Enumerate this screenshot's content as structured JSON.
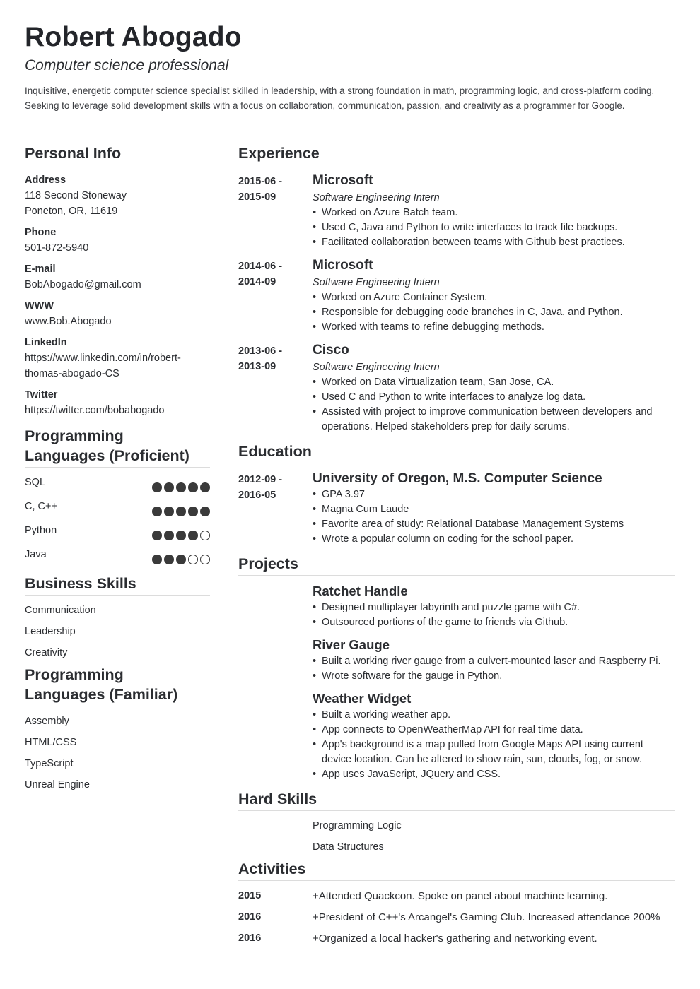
{
  "header": {
    "name": "Robert Abogado",
    "subtitle": "Computer science professional",
    "summary": "Inquisitive, energetic computer science specialist skilled in leadership, with a strong foundation in math, programming logic, and cross-platform coding. Seeking to leverage solid development skills with a focus on collaboration, communication, passion, and creativity as a programmer for Google."
  },
  "personal_info": {
    "title": "Personal Info",
    "items": [
      {
        "label": "Address",
        "lines": [
          "118 Second Stoneway",
          "Poneton, OR, 11619"
        ]
      },
      {
        "label": "Phone",
        "lines": [
          "501-872-5940"
        ]
      },
      {
        "label": "E-mail",
        "lines": [
          "BobAbogado@gmail.com"
        ]
      },
      {
        "label": "WWW",
        "lines": [
          "www.Bob.Abogado"
        ]
      },
      {
        "label": "LinkedIn",
        "lines": [
          "https://www.linkedin.com/in/robert-",
          "thomas-abogado-CS"
        ]
      },
      {
        "label": "Twitter",
        "lines": [
          "https://twitter.com/bobabogado"
        ]
      }
    ]
  },
  "languages_proficient": {
    "title_line1": "Programming",
    "title_line2": "Languages (Proficient)",
    "max_rating": 5,
    "items": [
      {
        "name": "SQL",
        "rating": 5
      },
      {
        "name": "C, C++",
        "rating": 5
      },
      {
        "name": "Python",
        "rating": 4
      },
      {
        "name": "Java",
        "rating": 3
      }
    ]
  },
  "business_skills": {
    "title": "Business Skills",
    "items": [
      "Communication",
      "Leadership",
      "Creativity"
    ]
  },
  "languages_familiar": {
    "title_line1": "Programming",
    "title_line2": "Languages (Familiar)",
    "items": [
      "Assembly",
      "HTML/CSS",
      "TypeScript",
      "Unreal Engine"
    ]
  },
  "experience": {
    "title": "Experience",
    "items": [
      {
        "date_start": "2015-06 -",
        "date_end": "2015-09",
        "company": "Microsoft",
        "role": "Software Engineering Intern",
        "bullets": [
          "Worked on Azure Batch team.",
          "Used C, Java and Python to write interfaces to track file backups.",
          "Facilitated collaboration between teams with Github best practices."
        ]
      },
      {
        "date_start": "2014-06 -",
        "date_end": "2014-09",
        "company": "Microsoft",
        "role": "Software Engineering Intern",
        "bullets": [
          "Worked on Azure Container System.",
          "Responsible for debugging code branches in C, Java, and Python.",
          "Worked with teams to refine debugging methods."
        ]
      },
      {
        "date_start": "2013-06 -",
        "date_end": "2013-09",
        "company": "Cisco",
        "role": "Software Engineering Intern",
        "bullets": [
          "Worked on Data Virtualization team, San Jose, CA.",
          "Used C and Python to write interfaces to analyze log data.",
          "Assisted with project to improve communication between developers and operations. Helped stakeholders prep for daily scrums."
        ]
      }
    ]
  },
  "education": {
    "title": "Education",
    "items": [
      {
        "date_start": "2012-09 -",
        "date_end": "2016-05",
        "school": "University of Oregon, M.S. Computer Science",
        "bullets": [
          "GPA 3.97",
          "Magna Cum Laude",
          "Favorite area of study: Relational Database Management Systems",
          "Wrote a popular column on coding for the school paper."
        ]
      }
    ]
  },
  "projects": {
    "title": "Projects",
    "items": [
      {
        "name": "Ratchet Handle",
        "bullets": [
          "Designed multiplayer labyrinth and puzzle game with C#.",
          "Outsourced portions of the game to friends via Github."
        ]
      },
      {
        "name": "River Gauge",
        "bullets": [
          "Built a working river gauge from a culvert-mounted laser and Raspberry Pi.",
          "Wrote software for the gauge in Python."
        ]
      },
      {
        "name": "Weather Widget",
        "bullets": [
          "Built a working weather app.",
          "App connects to OpenWeatherMap API for real time data.",
          "App's background is a map pulled from Google Maps API using current device location. Can be altered to show rain, sun, clouds, fog, or snow.",
          "App uses JavaScript, JQuery and CSS."
        ]
      }
    ]
  },
  "hard_skills": {
    "title": "Hard Skills",
    "items": [
      "Programming Logic",
      "Data Structures"
    ]
  },
  "activities": {
    "title": "Activities",
    "items": [
      {
        "year": "2015",
        "text": "+Attended Quackcon. Spoke on panel about machine learning."
      },
      {
        "year": "2016",
        "text": "+President of C++'s Arcangel's Gaming Club. Increased attendance 200%"
      },
      {
        "year": "2016",
        "text": "+Organized a local hacker's gathering and networking event."
      }
    ]
  }
}
